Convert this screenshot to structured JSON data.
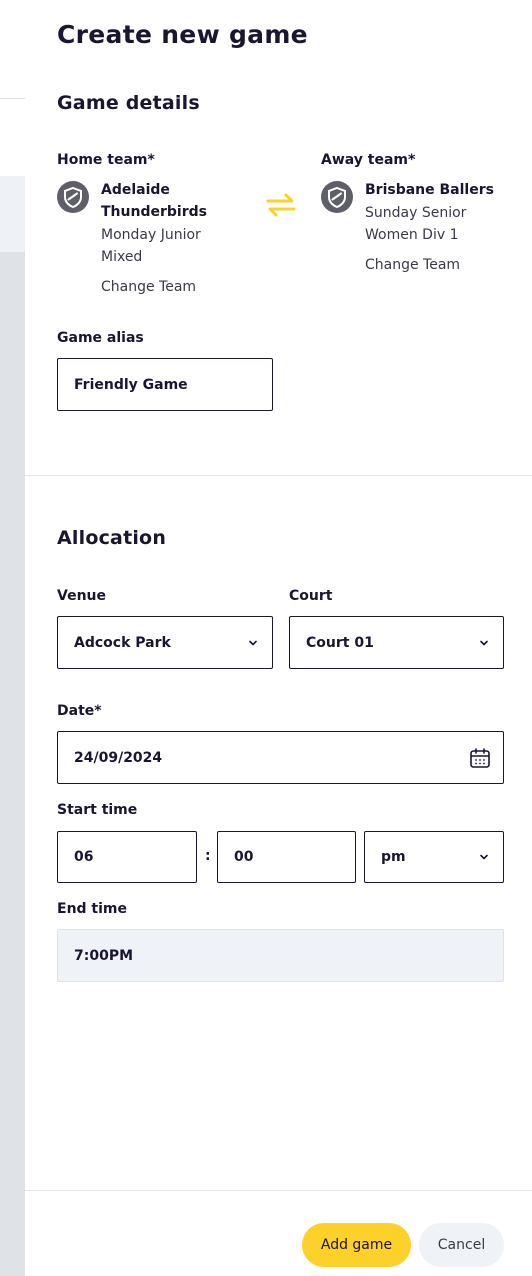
{
  "drawer": {
    "title": "Create new game"
  },
  "game_details": {
    "heading": "Game details",
    "home": {
      "label": "Home team*",
      "name_line1": "Adelaide",
      "name_line2": "Thunderbirds",
      "division_line1": "Monday Junior",
      "division_line2": "Mixed",
      "change_label": "Change Team"
    },
    "away": {
      "label": "Away team*",
      "name_line1": "Brisbane Ballers",
      "division_line1": "Sunday Senior",
      "division_line2": "Women Div 1",
      "change_label": "Change Team"
    },
    "swap_icon": "swap-arrows-icon",
    "alias": {
      "label": "Game alias",
      "value": "Friendly Game"
    }
  },
  "allocation": {
    "heading": "Allocation",
    "venue": {
      "label": "Venue",
      "value": "Adcock Park"
    },
    "court": {
      "label": "Court",
      "value": "Court 01"
    },
    "date": {
      "label": "Date*",
      "value": "24/09/2024",
      "icon": "calendar-icon"
    },
    "start_time": {
      "label": "Start time",
      "hour": "06",
      "separator": ":",
      "minute": "00",
      "period": "pm"
    },
    "end_time": {
      "label": "End time",
      "value": "7:00PM"
    }
  },
  "footer": {
    "add_label": "Add game",
    "cancel_label": "Cancel"
  },
  "colors": {
    "accent": "#fcd12a",
    "text": "#1b1530",
    "team_icon": "#5f5f69",
    "readonly_bg": "#eff2f6"
  }
}
